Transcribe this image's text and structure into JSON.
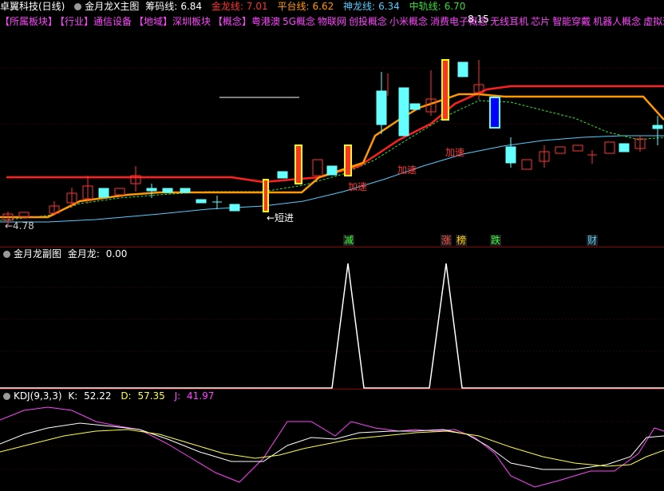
{
  "main": {
    "stock_title": "卓翼科技(日线)",
    "indicator_name": "金月龙X主图",
    "values": [
      {
        "label": "筹码线:",
        "value": "6.84",
        "color": "#ffffff"
      },
      {
        "label": "金龙线:",
        "value": "7.01",
        "color": "#ff3030"
      },
      {
        "label": "平台线:",
        "value": "6.62",
        "color": "#ff9900"
      },
      {
        "label": "神龙线:",
        "value": "6.34",
        "color": "#55ccff"
      },
      {
        "label": "中轨线:",
        "value": "6.70",
        "color": "#33dd33"
      }
    ],
    "sectors": [
      "【所属板块】",
      "【行业】通信设备",
      "【地域】深圳板块",
      "【概念】粤港澳",
      "5G概念",
      "物联网",
      "创投概念",
      "小米概念",
      "消费电子概念",
      "无线耳机",
      "芯片",
      "智能穿戴",
      "机器人概念",
      "虚拟现"
    ],
    "high_label": "8.15",
    "low_label": "←4.78",
    "annotations": {
      "short_entry": "←短进",
      "accel1": "加速",
      "accel2": "加速",
      "accel3": "加速"
    },
    "bottom_tags": [
      {
        "text": "减",
        "color": "#33ff33"
      },
      {
        "text": "涨",
        "color": "#ff4444"
      },
      {
        "text": "榜",
        "color": "#ffcc00"
      },
      {
        "text": "跌",
        "color": "#33ff33"
      },
      {
        "text": "财",
        "color": "#55ccff"
      }
    ]
  },
  "sub": {
    "indicator_name": "金月龙副图",
    "label": "金月龙:",
    "value": "0.00"
  },
  "kdj": {
    "indicator_name": "KDJ(9,3,3)",
    "k_label": "K:",
    "k_value": "52.22",
    "d_label": "D:",
    "d_value": "57.35",
    "j_label": "J:",
    "j_value": "41.97"
  }
}
